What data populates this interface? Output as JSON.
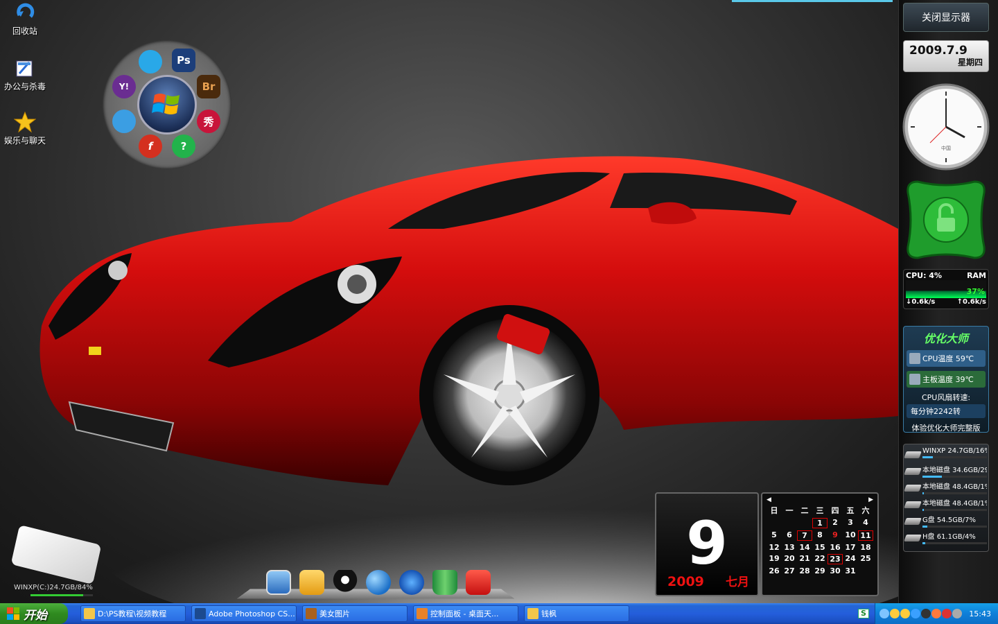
{
  "desktop_icons": [
    {
      "label": "回收站",
      "icon": "recycle-bin-icon"
    },
    {
      "label": "办公与杀毒",
      "icon": "office-folder-icon"
    },
    {
      "label": "娱乐与聊天",
      "icon": "star-icon"
    }
  ],
  "launcher": {
    "center": "windows-logo",
    "items": [
      {
        "label": "Ps",
        "color": "#2a6bd6"
      },
      {
        "label": "Br",
        "color": "#b66a1f"
      },
      {
        "label": "秀",
        "color": "#c8143a"
      },
      {
        "label": "?",
        "color": "#22b34b"
      },
      {
        "label": "f",
        "color": "#d4301f"
      },
      {
        "label": "",
        "color": "#3b9ee3"
      },
      {
        "label": "Y!",
        "color": "#6a2d91"
      },
      {
        "label": "",
        "color": "#29a8e8"
      }
    ]
  },
  "sidebar": {
    "close_display": "关闭显示器",
    "date": "2009.7.9",
    "weekday": "星期四",
    "clock_brand": "中国",
    "cpu_label": "CPU: 4%",
    "ram_label": "RAM",
    "ram_pct": "37%",
    "net_down": "0.6k/s",
    "net_up": "0.6k/s",
    "optimizer": {
      "title": "优化大师",
      "cpu_temp": "CPU温度  59℃",
      "mb_temp": "主板温度  39℃",
      "fan_label": "CPU风扇转速:",
      "fan_value": "每分钟2242转",
      "footer": "体验优化大师完整版"
    },
    "drives": [
      {
        "label": "WINXP 24.7GB/16%",
        "usage": 0.16
      },
      {
        "label": "本地磁盘 34.6GB/29",
        "usage": 0.29
      },
      {
        "label": "本地磁盘 48.4GB/1%",
        "usage": 0.01
      },
      {
        "label": "本地磁盘 48.4GB/1%",
        "usage": 0.01
      },
      {
        "label": "G盘 54.5GB/7%",
        "usage": 0.07
      },
      {
        "label": "H盘 61.1GB/4%",
        "usage": 0.04
      }
    ]
  },
  "calendar": {
    "day": "9",
    "year": "2009",
    "month": "七月",
    "weekdays": [
      "日",
      "一",
      "二",
      "三",
      "四",
      "五",
      "六"
    ],
    "weeks": [
      [
        "",
        "",
        "",
        "1",
        "2",
        "3",
        "4"
      ],
      [
        "5",
        "6",
        "7",
        "8",
        "9",
        "10",
        "11"
      ],
      [
        "12",
        "13",
        "14",
        "15",
        "16",
        "17",
        "18"
      ],
      [
        "19",
        "20",
        "21",
        "22",
        "23",
        "24",
        "25"
      ],
      [
        "26",
        "27",
        "28",
        "29",
        "30",
        "31",
        ""
      ]
    ],
    "highlighted": [
      "1",
      "7",
      "11",
      "23"
    ],
    "red": [
      "9"
    ]
  },
  "usb": {
    "label": "WINXP(C:)24.7GB/84%",
    "usage": 0.84
  },
  "dock": [
    "computer-icon",
    "folder-icon",
    "qq-penguin-icon",
    "globe-icon",
    "media-player-icon",
    "recycle-can-icon",
    "power-icon"
  ],
  "taskbar": {
    "start": "开始",
    "buttons": [
      {
        "label": "D:\\PS教程\\视频教程",
        "icon": "folder-icon",
        "color": "#f3c64a"
      },
      {
        "label": "Adobe Photoshop CS...",
        "icon": "photoshop-icon",
        "color": "#1c4a8f"
      },
      {
        "label": "美女图片",
        "icon": "bridge-icon",
        "color": "#a9611f"
      },
      {
        "label": "控制面板 - 桌面天...",
        "icon": "firefox-icon",
        "color": "#e8822a"
      },
      {
        "label": "钱枫",
        "icon": "folder-icon",
        "color": "#f3c64a"
      }
    ],
    "ime": "S",
    "clock": "15:43"
  }
}
